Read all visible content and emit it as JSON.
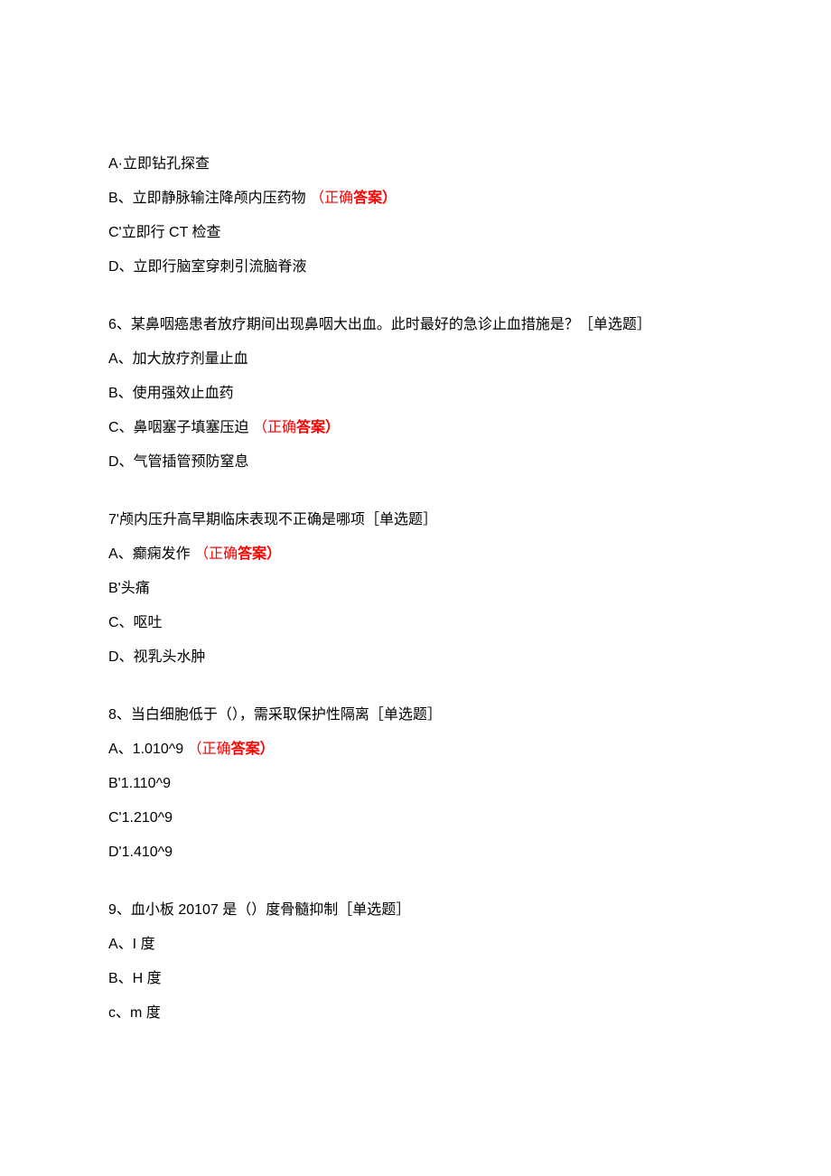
{
  "q5": {
    "optA": "A·立即钻孔探查",
    "optB_pre": "B、立即静脉输注降颅内压药物",
    "optB_ans": "（正确答案）",
    "optC": "C'立即行 CT 检查",
    "optD": "D、立即行脑室穿刺引流脑脊液"
  },
  "q6": {
    "stem": "6、某鼻咽癌患者放疗期间出现鼻咽大出血。此时最好的急诊止血措施是？［单选题］",
    "optA": "A、加大放疗剂量止血",
    "optB": "B、使用强效止血药",
    "optC_pre": "C、鼻咽塞子填塞压迫",
    "optC_ans": "（正确答案）",
    "optD": "D、气管插管预防窒息"
  },
  "q7": {
    "stem": "7'颅内压升高早期临床表现不正确是哪项［单选题］",
    "optA_pre": "A、癫痫发作",
    "optA_ans": "（正确答案）",
    "optB": "B'头痛",
    "optC": "C、呕吐",
    "optD": "D、视乳头水肿"
  },
  "q8": {
    "stem": "8、当白细胞低于（），需采取保护性隔离［单选题］",
    "optA_pre": "A、1.010^9",
    "optA_ans": "（正确答案）",
    "optB": "B'1.110^9",
    "optC": "C'1.210^9",
    "optD": "D'1.410^9"
  },
  "q9": {
    "stem": "9、血小板 20107 是（）度骨髓抑制［单选题］",
    "optA": "A、I 度",
    "optB": "B、H 度",
    "optC": "c、m 度"
  }
}
